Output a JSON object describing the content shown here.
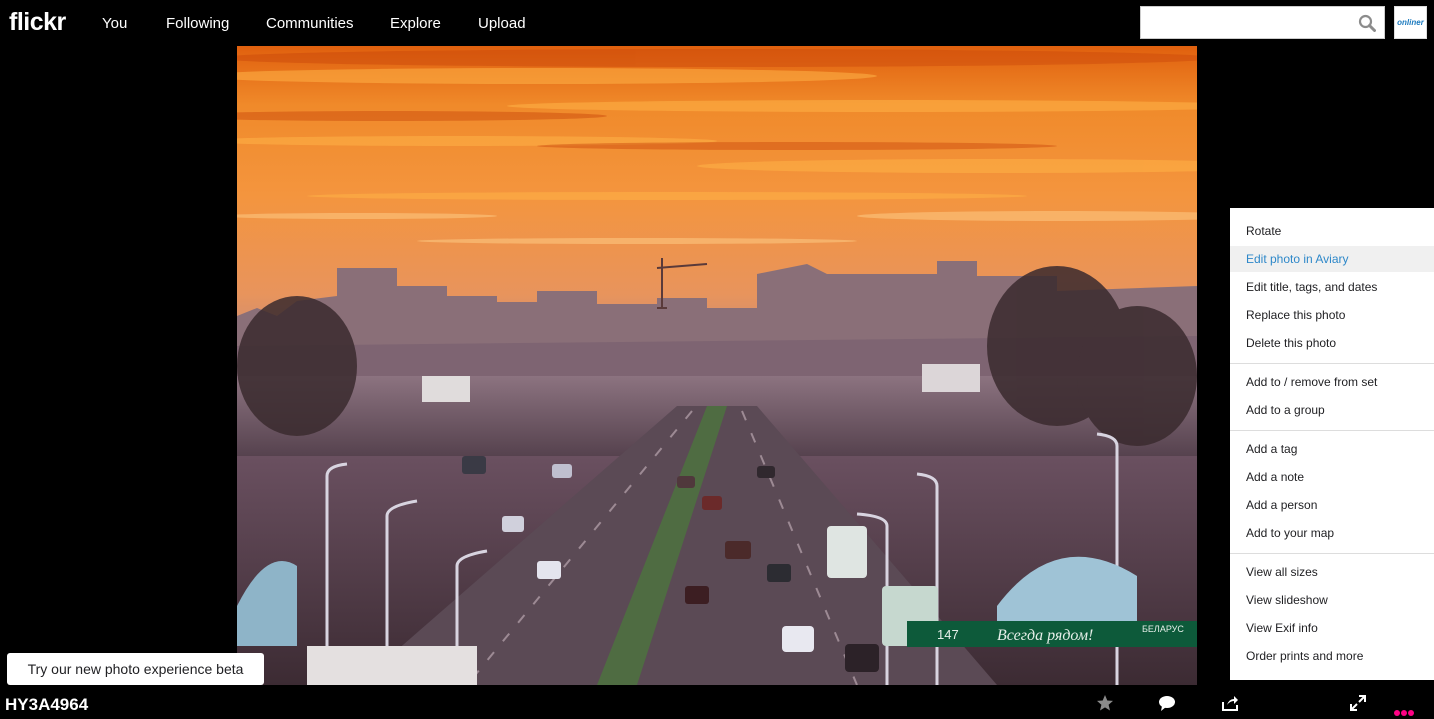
{
  "header": {
    "logo": "flickr",
    "nav": [
      "You",
      "Following",
      "Communities",
      "Explore",
      "Upload"
    ],
    "search": {
      "value": "",
      "placeholder": ""
    },
    "avatar_text": "onliner"
  },
  "menu": {
    "groups": [
      [
        "Rotate",
        "Edit photo in Aviary",
        "Edit title, tags, and dates",
        "Replace this photo",
        "Delete this photo"
      ],
      [
        "Add to / remove from set",
        "Add to a group"
      ],
      [
        "Add a tag",
        "Add a note",
        "Add a person",
        "Add to your map"
      ],
      [
        "View all sizes",
        "View slideshow",
        "View Exif info",
        "Order prints and more"
      ]
    ],
    "highlighted": "Edit photo in Aviary"
  },
  "beta_banner": "Try our new photo experience beta",
  "photo": {
    "title": "HY3A4964",
    "sign_text": "Всегда рядом!",
    "sign_number": "147",
    "sign_brand": "БЕЛАРУС"
  },
  "toolbar": {
    "icons": [
      "star-icon",
      "comment-icon",
      "share-icon",
      "fullscreen-icon",
      "more-icon"
    ]
  },
  "colors": {
    "accent": "#ff0084",
    "link": "#2e88c9",
    "background": "#000000"
  }
}
